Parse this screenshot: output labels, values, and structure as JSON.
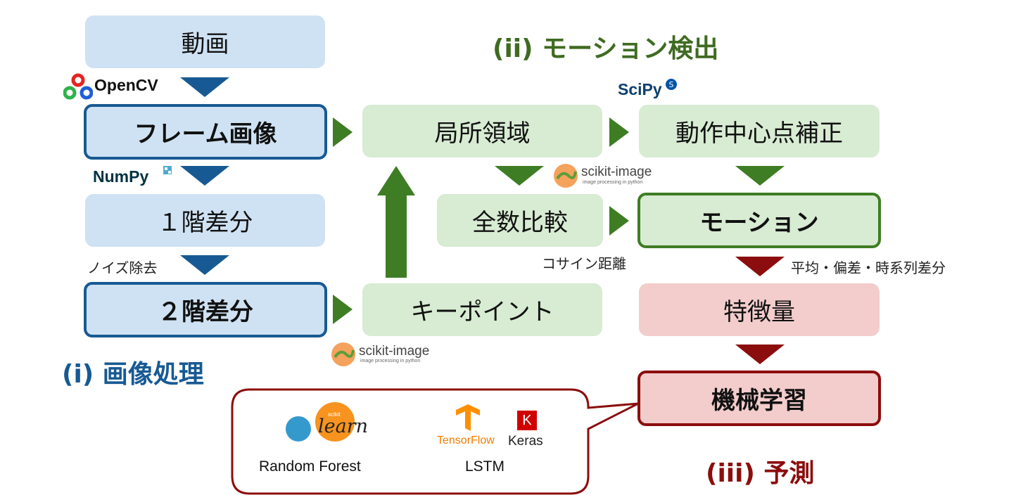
{
  "sections": {
    "image_processing": "(i) 画像処理",
    "motion_detection": "(ii) モーション検出",
    "prediction": "(iii) 予測"
  },
  "boxes": {
    "video": "動画",
    "frame_image": "フレーム画像",
    "first_diff": "１階差分",
    "second_diff": "２階差分",
    "local_region": "局所領域",
    "motion_center": "動作中心点補正",
    "full_compare": "全数比較",
    "motion": "モーション",
    "keypoint": "キーポイント",
    "features": "特徴量",
    "ml": "機械学習"
  },
  "notes": {
    "noise_removal": "ノイズ除去",
    "cosine_distance": "コサイン距離",
    "feature_stats": "平均・偏差・時系列差分"
  },
  "logos": {
    "opencv": "OpenCV",
    "numpy": "NumPy",
    "scipy": "SciPy",
    "scikit_image": "scikit-image",
    "scikit_image_sub": "image processing in python",
    "sklearn_small": "scikit",
    "sklearn": "learn",
    "tensorflow": "TensorFlow",
    "keras_mark": "K",
    "keras": "Keras"
  },
  "callout": {
    "left_label": "Random Forest",
    "right_label": "LSTM"
  },
  "colors": {
    "blue_fill": "#cfe2f3",
    "blue_border": "#175a93",
    "green_fill": "#d8ebd3",
    "green_border": "#3f7d24",
    "red_fill": "#f3cccc",
    "red_border": "#8c0d0d"
  }
}
